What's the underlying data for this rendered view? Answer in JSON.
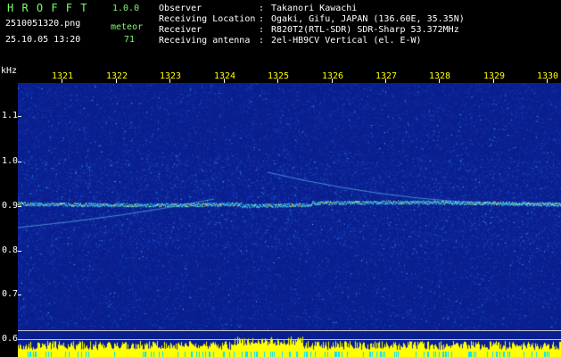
{
  "header": {
    "app_name": "H R O F F T",
    "version": "1.0.0",
    "filename": "2510051320.png",
    "datetime": "25.10.05 13:20",
    "meteor_label": "meteor",
    "meteor_count": "71"
  },
  "info": {
    "rows": [
      {
        "label": "Observer",
        "value": "Takanori Kawachi"
      },
      {
        "label": "Receiving Location",
        "value": "Ogaki, Gifu, JAPAN (136.60E, 35.35N)"
      },
      {
        "label": "Receiver",
        "value": "R820T2(RTL-SDR) SDR-Sharp 53.372MHz"
      },
      {
        "label": "Receiving antenna",
        "value": "2el-HB9CV Vertical (el. E-W)"
      }
    ],
    "separator": ":"
  },
  "axes": {
    "y_unit": "kHz",
    "y_ticks": [
      "1.1",
      "1.0",
      "0.9",
      "0.8",
      "0.7",
      "0.6"
    ],
    "x_ticks": [
      "1321",
      "1322",
      "1323",
      "1324",
      "1325",
      "1326",
      "1327",
      "1328",
      "1329",
      "1330"
    ]
  },
  "colors": {
    "label_green": "#7cfc6a",
    "text_white": "#ffffff",
    "tick_yellow": "#ffff00",
    "spectrogram_bg": "#0a1f8f",
    "activity_bar": "#ffff00",
    "activity_low": "#00e0ff"
  }
}
